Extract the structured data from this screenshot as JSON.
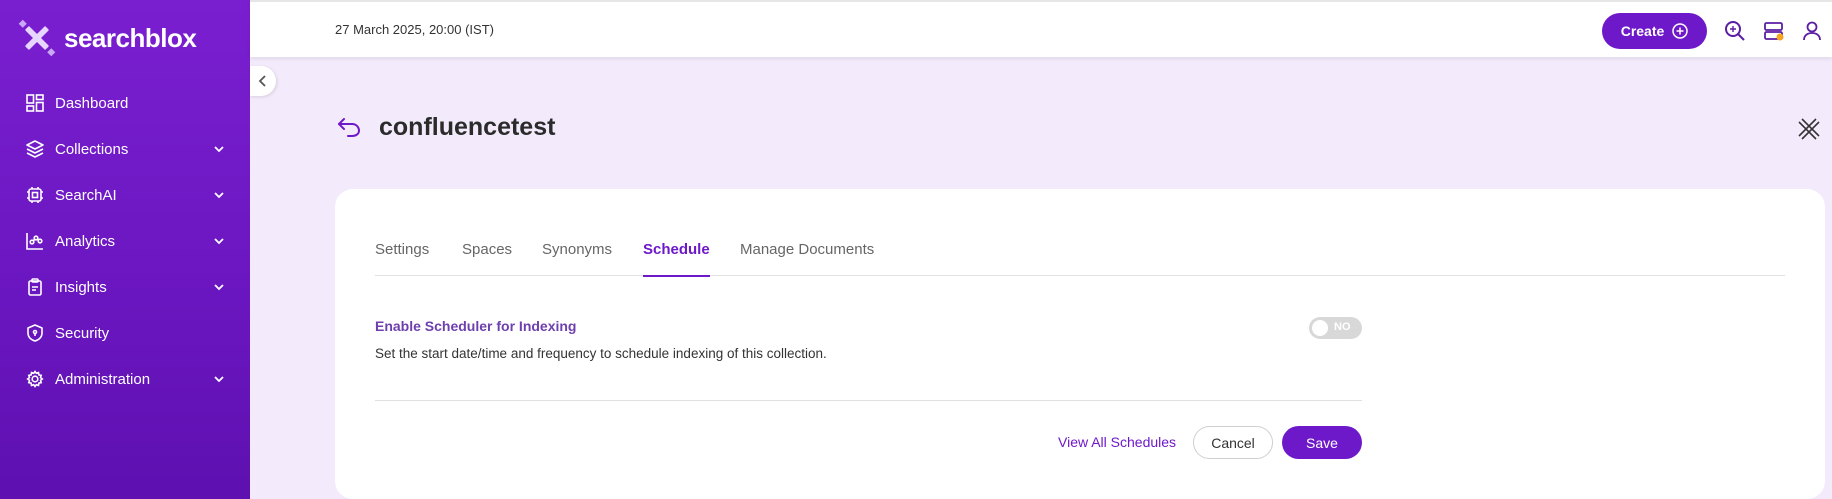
{
  "brand": {
    "name": "searchblox"
  },
  "sidebar": {
    "items": [
      {
        "label": "Dashboard",
        "icon": "dashboard-icon",
        "expandable": false
      },
      {
        "label": "Collections",
        "icon": "layers-icon",
        "expandable": true
      },
      {
        "label": "SearchAI",
        "icon": "chip-icon",
        "expandable": true
      },
      {
        "label": "Analytics",
        "icon": "analytics-icon",
        "expandable": true
      },
      {
        "label": "Insights",
        "icon": "clipboard-icon",
        "expandable": true
      },
      {
        "label": "Security",
        "icon": "shield-icon",
        "expandable": false
      },
      {
        "label": "Administration",
        "icon": "gear-icon",
        "expandable": true
      }
    ]
  },
  "header": {
    "datetime": "27 March 2025, 20:00 (IST)",
    "create_label": "Create"
  },
  "page": {
    "title": "confluencetest"
  },
  "tabs": [
    {
      "label": "Settings",
      "active": false
    },
    {
      "label": "Spaces",
      "active": false
    },
    {
      "label": "Synonyms",
      "active": false
    },
    {
      "label": "Schedule",
      "active": true
    },
    {
      "label": "Manage Documents",
      "active": false
    }
  ],
  "schedule": {
    "title": "Enable Scheduler for Indexing",
    "description": "Set the start date/time and frequency to schedule indexing of this collection.",
    "toggle_label": "NO",
    "enabled": false,
    "view_all_label": "View All Schedules",
    "cancel_label": "Cancel",
    "save_label": "Save"
  },
  "colors": {
    "accent": "#6e19c9",
    "sidebar": "#7a1fd0",
    "page_bg": "#f3ebfb"
  }
}
